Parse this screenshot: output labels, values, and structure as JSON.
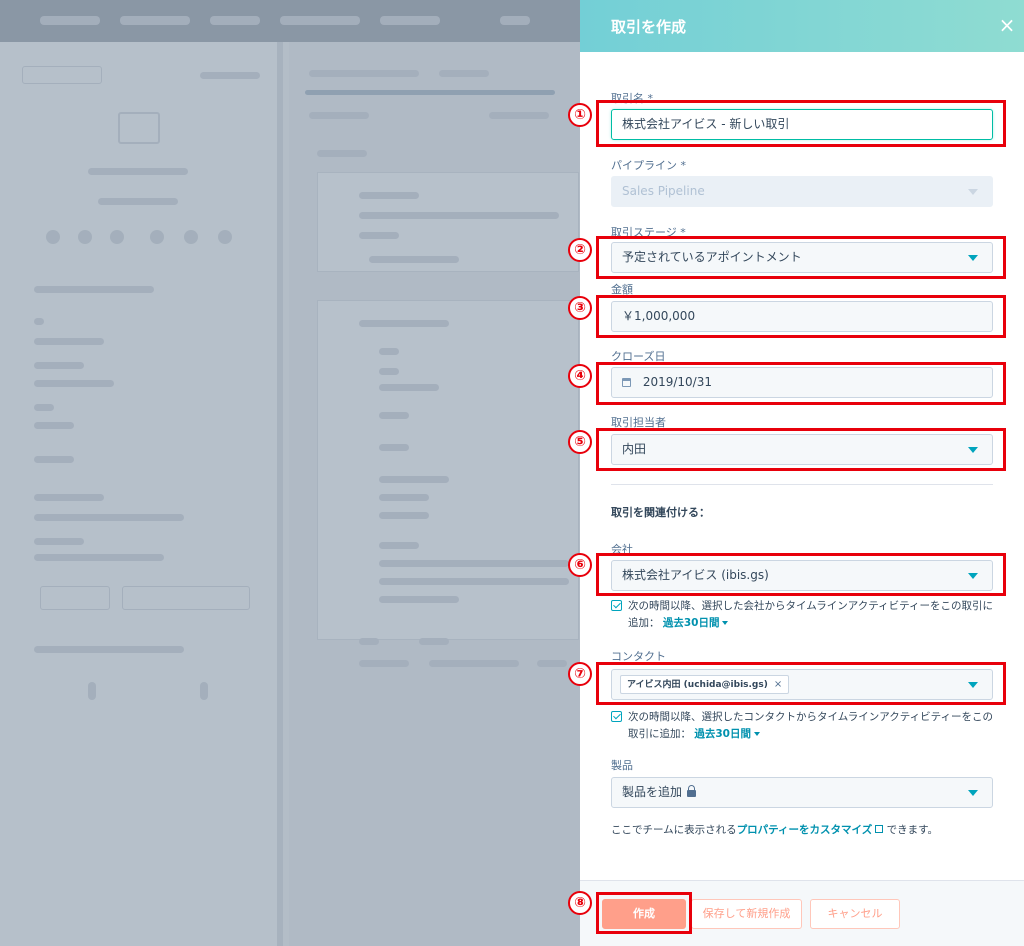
{
  "panel": {
    "title": "取引を作成",
    "close_symbol": "×"
  },
  "fields": {
    "deal_name": {
      "label": "取引名 *",
      "value": "株式会社アイビス - 新しい取引"
    },
    "pipeline": {
      "label": "パイプライン *",
      "value": "Sales Pipeline"
    },
    "stage": {
      "label": "取引ステージ *",
      "value": "予定されているアポイントメント"
    },
    "amount": {
      "label": "金額",
      "value": "￥1,000,000"
    },
    "close_date": {
      "label": "クローズ日",
      "value": "2019/10/31"
    },
    "owner": {
      "label": "取引担当者",
      "value": "内田"
    }
  },
  "associate": {
    "title": "取引を関連付ける：",
    "company": {
      "label": "会社",
      "value": "株式会社アイビス (ibis.gs)",
      "checkbox_text": "次の時間以降、選択した会社からタイムラインアクティビティーをこの取引に追加：",
      "period": "過去30日間"
    },
    "contact": {
      "label": "コンタクト",
      "chip": "アイビス内田 (uchida@ibis.gs)",
      "chip_remove": "×",
      "checkbox_text": "次の時間以降、選択したコンタクトからタイムラインアクティビティーをこの取引に追加：",
      "period": "過去30日間"
    },
    "product": {
      "label": "製品",
      "value": "製品を追加"
    }
  },
  "help": {
    "prefix": "ここでチームに表示される",
    "link": "プロパティーをカスタマイズ",
    "suffix": " できます。"
  },
  "footer": {
    "create": "作成",
    "save_new": "保存して新規作成",
    "cancel": "キャンセル"
  },
  "annotations": [
    "①",
    "②",
    "③",
    "④",
    "⑤",
    "⑥",
    "⑦",
    "⑧"
  ],
  "colors": {
    "header_start": "#73cfd6",
    "header_end": "#8fdcd2",
    "annotation_red": "#e8000b",
    "primary_button": "#ff9f8a",
    "link": "#0091ae"
  },
  "icons": {
    "close": "close-icon",
    "dropdown": "chevron-down-icon",
    "date": "calendar-icon",
    "lock": "lock-icon",
    "external": "external-link-icon"
  }
}
